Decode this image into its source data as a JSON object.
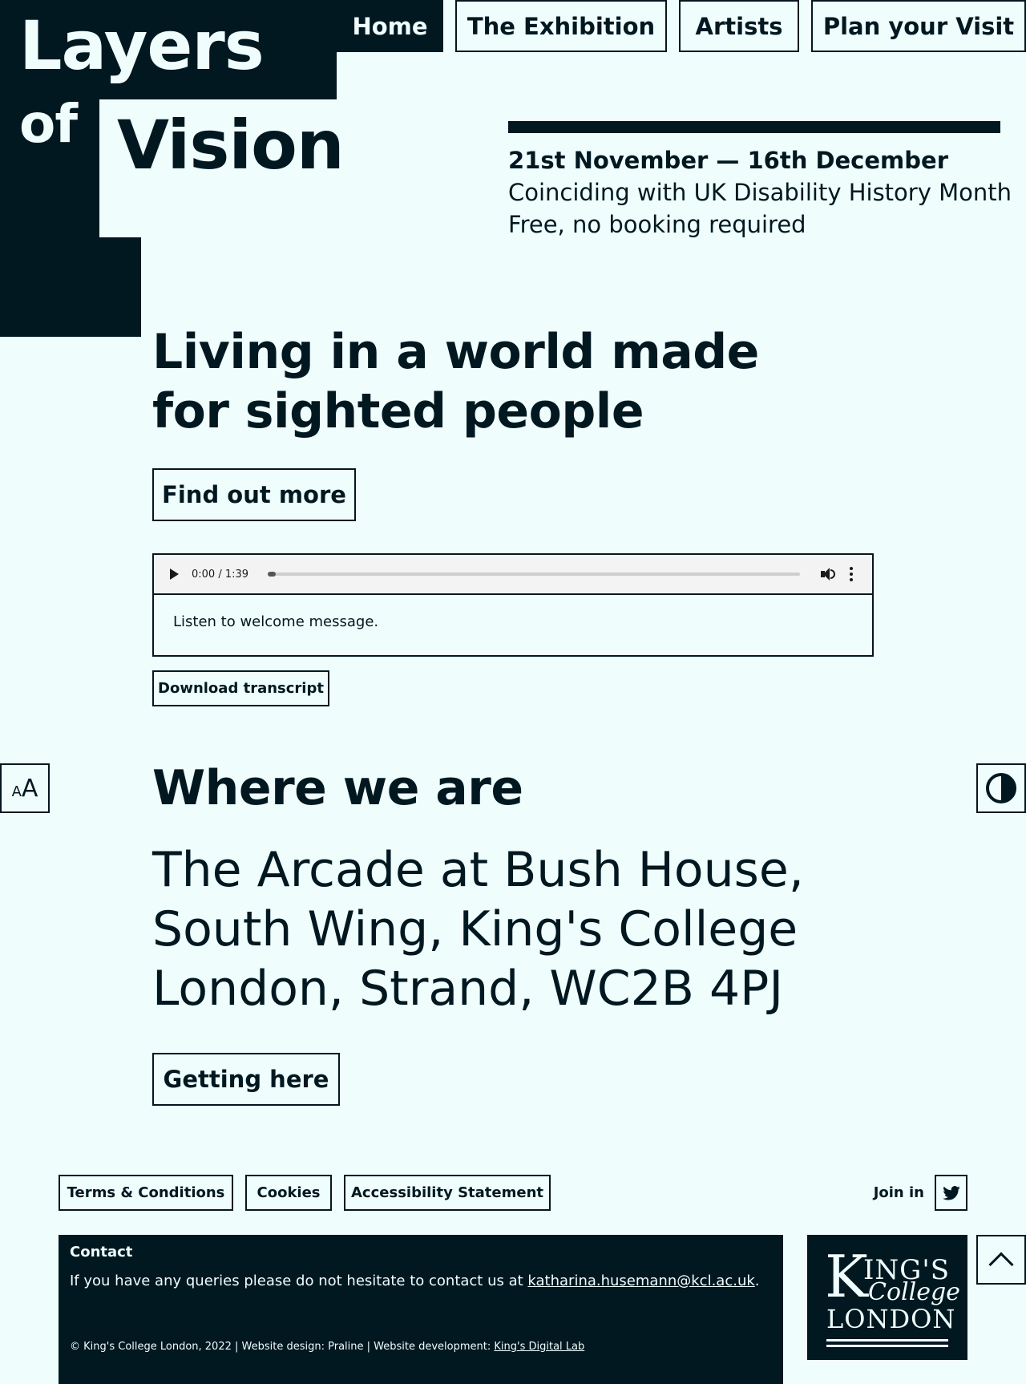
{
  "site": {
    "logo_words": [
      "Layers",
      "of",
      "Vision"
    ]
  },
  "nav": {
    "items": [
      {
        "label": "Home",
        "active": true
      },
      {
        "label": "The Exhibition"
      },
      {
        "label": "Artists"
      },
      {
        "label": "Plan your Visit"
      }
    ]
  },
  "dates": {
    "range": "21st November — 16th December",
    "note": "Coinciding with UK Disability History Month",
    "price": "Free, no booking required"
  },
  "hero": {
    "title": "Living in a world made for sighted people",
    "cta": "Find out more"
  },
  "audio": {
    "time": "0:00 / 1:39",
    "progress": 0.0,
    "caption": "Listen to welcome message.",
    "transcript_button": "Download transcript"
  },
  "tools": {
    "text_size_small": "A",
    "text_size_big": "A",
    "icons": [
      "text-size-icon",
      "contrast-icon",
      "back-to-top-icon"
    ]
  },
  "where": {
    "title": "Where we are",
    "address": "The Arcade at Bush House, South Wing, King's College London, Strand, WC2B 4PJ",
    "cta": "Getting here"
  },
  "footer": {
    "links": [
      "Terms & Conditions",
      "Cookies",
      "Accessibility Statement"
    ],
    "join_label": "Join in",
    "contact": {
      "title": "Contact",
      "text": "If you have any queries please do not hesitate to contact us at ",
      "email": "katharina.husemann@kcl.ac.uk",
      "after": "."
    },
    "credits": {
      "text": "© King's College London, 2022 | Website design: Praline | Website development: ",
      "link": "King's Digital Lab"
    },
    "kcl_logo": {
      "k": "K",
      "ings": "ING'S",
      "college": "College",
      "london": "LONDON"
    }
  },
  "colors": {
    "background": "#effdfd",
    "ink": "#021820"
  }
}
